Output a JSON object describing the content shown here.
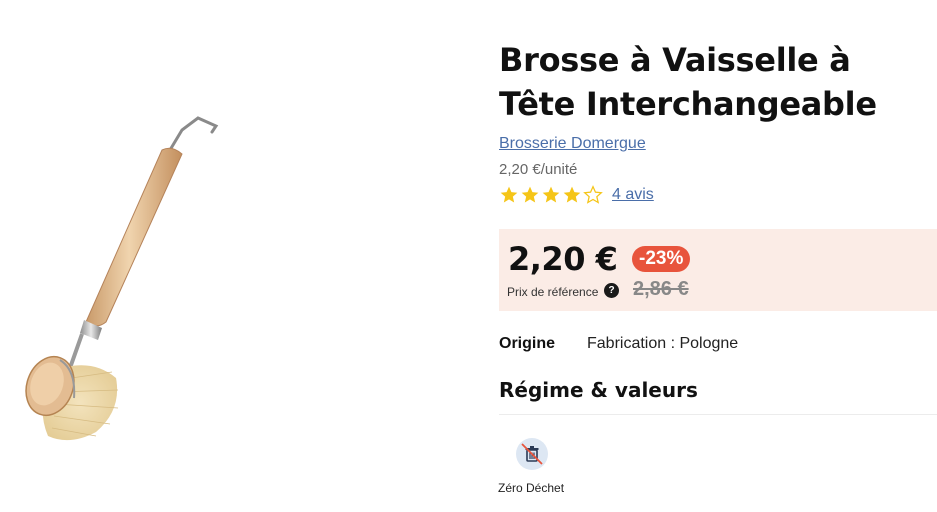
{
  "product": {
    "title": "Brosse à Vaisselle à Tête Interchangeable",
    "brand": "Brosserie Domergue",
    "unit_price": "2,20 €/unité",
    "rating": 4,
    "rating_max": 5,
    "reviews_label": "4 avis"
  },
  "pricing": {
    "price": "2,20 €",
    "discount": "-23%",
    "reference_label": "Prix de référence",
    "help_icon": "question-icon",
    "old_price": "2,86 €"
  },
  "details": {
    "origin_label": "Origine",
    "origin_value": "Fabrication : Pologne"
  },
  "values_section": {
    "title": "Régime & valeurs",
    "badges": [
      {
        "label": "Zéro Déchet",
        "icon": "no-waste-trash-icon"
      }
    ]
  },
  "colors": {
    "star": "#f5c518",
    "link": "#4a6ea9",
    "discount_bg": "#e8543c",
    "price_box_bg": "#fbece6"
  }
}
